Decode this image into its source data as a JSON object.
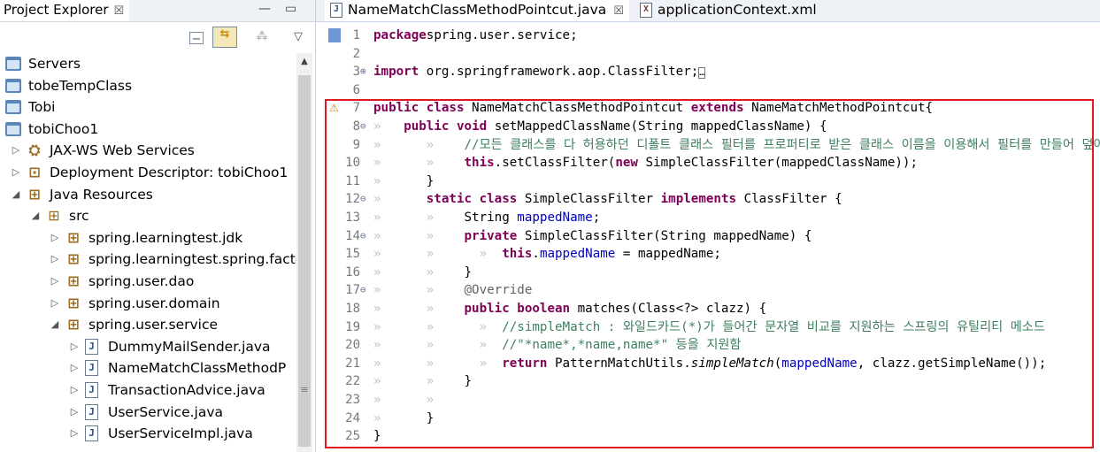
{
  "explorer": {
    "title": "Project Explorer",
    "close_glyph": "☒",
    "minimize_glyph": "—",
    "maximize_glyph": "▭",
    "toolbar": [
      "collapse-all-icon",
      "link-with-editor-icon",
      "filters-icon",
      "view-menu-icon"
    ],
    "tree": [
      {
        "label": "Servers",
        "icon": "folder-icon",
        "depth": 0,
        "twisty": ""
      },
      {
        "label": "tobeTempClass",
        "icon": "folder-icon",
        "depth": 0,
        "twisty": ""
      },
      {
        "label": "Tobi",
        "icon": "folder-icon",
        "depth": 0,
        "twisty": ""
      },
      {
        "label": "tobiChoo1",
        "icon": "project-icon",
        "depth": 0,
        "twisty": ""
      },
      {
        "label": "JAX-WS Web Services",
        "icon": "webservice-icon",
        "depth": 1,
        "twisty": "▷"
      },
      {
        "label": "Deployment Descriptor: tobiChoo1",
        "icon": "descriptor-icon",
        "depth": 1,
        "twisty": "▷"
      },
      {
        "label": "Java Resources",
        "icon": "java-resources-icon",
        "depth": 1,
        "twisty": "◢"
      },
      {
        "label": "src",
        "icon": "source-folder-icon",
        "depth": 2,
        "twisty": "◢"
      },
      {
        "label": "spring.learningtest.jdk",
        "icon": "package-icon",
        "depth": 3,
        "twisty": "▷"
      },
      {
        "label": "spring.learningtest.spring.facto",
        "icon": "package-icon",
        "depth": 3,
        "twisty": "▷"
      },
      {
        "label": "spring.user.dao",
        "icon": "package-icon",
        "depth": 3,
        "twisty": "▷"
      },
      {
        "label": "spring.user.domain",
        "icon": "package-icon",
        "depth": 3,
        "twisty": "▷"
      },
      {
        "label": "spring.user.service",
        "icon": "package-icon",
        "depth": 3,
        "twisty": "◢"
      },
      {
        "label": "DummyMailSender.java",
        "icon": "java-file-icon",
        "depth": 4,
        "twisty": "▷"
      },
      {
        "label": "NameMatchClassMethodP",
        "icon": "java-file-icon",
        "depth": 4,
        "twisty": "▷"
      },
      {
        "label": "TransactionAdvice.java",
        "icon": "java-file-icon",
        "depth": 4,
        "twisty": "▷"
      },
      {
        "label": "UserService.java",
        "icon": "java-file-icon",
        "depth": 4,
        "twisty": "▷"
      },
      {
        "label": "UserServiceImpl.java",
        "icon": "java-file-icon",
        "depth": 4,
        "twisty": "▷"
      }
    ]
  },
  "editor": {
    "tabs": [
      {
        "label": "NameMatchClassMethodPointcut.java",
        "icon_letter": "J",
        "active": true
      },
      {
        "label": "applicationContext.xml",
        "icon_letter": "X",
        "active": false
      }
    ],
    "lines": [
      {
        "n": "1",
        "fold": "",
        "tokens": [
          [
            "kw",
            "package"
          ],
          [
            "",
            "spring.user.service;"
          ]
        ]
      },
      {
        "n": "2",
        "fold": "",
        "tokens": []
      },
      {
        "n": "3",
        "fold": "⊕",
        "tokens": [
          [
            "kw",
            "import"
          ],
          [
            "",
            " org.springframework.aop.ClassFilter;"
          ],
          [
            "box",
            "…"
          ]
        ]
      },
      {
        "n": "6",
        "fold": "",
        "tokens": []
      },
      {
        "n": "7",
        "fold": "",
        "tokens": [
          [
            "kw",
            "public"
          ],
          [
            "",
            " "
          ],
          [
            "kw",
            "class"
          ],
          [
            "",
            " NameMatchClassMethodPointcut "
          ],
          [
            "kw",
            "extends"
          ],
          [
            "",
            " NameMatchMethodPointcut{"
          ]
        ]
      },
      {
        "n": "8",
        "fold": "⊖",
        "tokens": [
          [
            "ws",
            "» "
          ],
          [
            "",
            "  "
          ],
          [
            "kw",
            "public"
          ],
          [
            "",
            " "
          ],
          [
            "kw",
            "void"
          ],
          [
            "",
            " setMappedClassName(String mappedClassName) {"
          ]
        ]
      },
      {
        "n": "9",
        "fold": "",
        "tokens": [
          [
            "ws",
            "»      »    "
          ],
          [
            "cmt",
            "//모든 클래스를 다 허용하던 디폴트 클래스 필터를 프로퍼티로 받은 클래스 이름을 이용해서 필터를 만들어 덮어씌운다."
          ]
        ]
      },
      {
        "n": "10",
        "fold": "",
        "tokens": [
          [
            "ws",
            "»      »    "
          ],
          [
            "kw",
            "this"
          ],
          [
            "",
            ".setClassFilter("
          ],
          [
            "kw",
            "new"
          ],
          [
            "",
            " SimpleClassFilter(mappedClassName));"
          ]
        ]
      },
      {
        "n": "11",
        "fold": "",
        "tokens": [
          [
            "ws",
            "»      "
          ],
          [
            "",
            "}"
          ]
        ]
      },
      {
        "n": "12",
        "fold": "⊖",
        "tokens": [
          [
            "ws",
            "»      "
          ],
          [
            "kw",
            "static"
          ],
          [
            "",
            " "
          ],
          [
            "kw",
            "class"
          ],
          [
            "",
            " SimpleClassFilter "
          ],
          [
            "kw",
            "implements"
          ],
          [
            "",
            " ClassFilter {"
          ]
        ]
      },
      {
        "n": "13",
        "fold": "",
        "tokens": [
          [
            "ws",
            "»      »    "
          ],
          [
            "",
            "String "
          ],
          [
            "fld",
            "mappedName"
          ],
          [
            "",
            ";"
          ]
        ]
      },
      {
        "n": "14",
        "fold": "⊖",
        "tokens": [
          [
            "ws",
            "»      »    "
          ],
          [
            "kw",
            "private"
          ],
          [
            "",
            " SimpleClassFilter(String mappedName) {"
          ]
        ]
      },
      {
        "n": "15",
        "fold": "",
        "tokens": [
          [
            "ws",
            "»      »      »  "
          ],
          [
            "kw",
            "this"
          ],
          [
            "",
            "."
          ],
          [
            "fld",
            "mappedName"
          ],
          [
            "",
            " = mappedName;"
          ]
        ]
      },
      {
        "n": "16",
        "fold": "",
        "tokens": [
          [
            "ws",
            "»      »    "
          ],
          [
            "",
            "}"
          ]
        ]
      },
      {
        "n": "17",
        "fold": "⊖",
        "tokens": [
          [
            "ws",
            "»      »    "
          ],
          [
            "ann",
            "@Override"
          ]
        ]
      },
      {
        "n": "18",
        "fold": "",
        "tokens": [
          [
            "ws",
            "»      »    "
          ],
          [
            "kw",
            "public"
          ],
          [
            "",
            " "
          ],
          [
            "kw",
            "boolean"
          ],
          [
            "",
            " matches(Class<?> clazz) {"
          ]
        ]
      },
      {
        "n": "19",
        "fold": "",
        "tokens": [
          [
            "ws",
            "»      »      »  "
          ],
          [
            "cmt",
            "//simpleMatch : 와일드카드(*)가 들어간 문자열 비교를 지원하는 스프링의 유틸리티 메소드"
          ]
        ]
      },
      {
        "n": "20",
        "fold": "",
        "tokens": [
          [
            "ws",
            "»      »      »  "
          ],
          [
            "cmt",
            "//\"*name*,*name,name*\" 등을 지원함"
          ]
        ]
      },
      {
        "n": "21",
        "fold": "",
        "tokens": [
          [
            "ws",
            "»      »      »  "
          ],
          [
            "kw",
            "return"
          ],
          [
            "",
            " PatternMatchUtils."
          ],
          [
            "ital",
            "simpleMatch"
          ],
          [
            "",
            "("
          ],
          [
            "fld",
            "mappedName"
          ],
          [
            "",
            ", clazz.getSimpleName());"
          ]
        ]
      },
      {
        "n": "22",
        "fold": "",
        "tokens": [
          [
            "ws",
            "»      »    "
          ],
          [
            "",
            "}"
          ]
        ]
      },
      {
        "n": "23",
        "fold": "",
        "tokens": [
          [
            "ws",
            "»      »"
          ]
        ]
      },
      {
        "n": "24",
        "fold": "",
        "tokens": [
          [
            "ws",
            "»      "
          ],
          [
            "",
            "}"
          ]
        ]
      },
      {
        "n": "25",
        "fold": "",
        "tokens": [
          [
            "",
            "}"
          ]
        ]
      }
    ]
  }
}
